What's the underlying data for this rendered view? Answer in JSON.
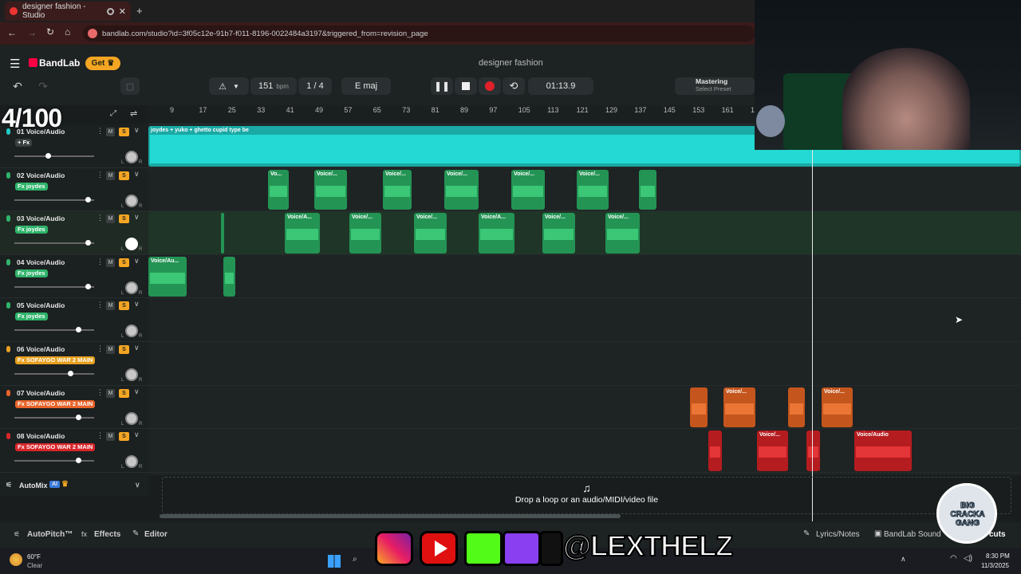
{
  "browser": {
    "tab_title": "designer fashion - Studio",
    "url": "bandlab.com/studio?id=3f05c12e-91b7-f011-8196-0022484a3197&triggered_from=revision_page"
  },
  "header": {
    "logo_text": "BandLab",
    "get_label": "Get",
    "project_title": "designer fashion",
    "bpm_value": "151",
    "bpm_unit": "bpm",
    "time_sig": "1 / 4",
    "key": "E maj",
    "time": "01:13.9",
    "mastering_title": "Mastering",
    "mastering_sub": "Select Preset"
  },
  "ruler": [
    "9",
    "17",
    "25",
    "33",
    "41",
    "49",
    "57",
    "65",
    "73",
    "81",
    "89",
    "97",
    "105",
    "113",
    "121",
    "129",
    "137",
    "145",
    "153",
    "161",
    "16"
  ],
  "tracks": [
    {
      "name": "01 Voice/Audio",
      "fx": "+ Fx",
      "color": "#23c9c4",
      "fx_bg": "#3a4041",
      "vol": 0.42
    },
    {
      "name": "02 Voice/Audio",
      "fx": "Fx joydes",
      "color": "#2fb36a",
      "fx_bg": "#2fb36a",
      "vol": 0.92
    },
    {
      "name": "03 Voice/Audio",
      "fx": "Fx joydes",
      "color": "#2fb36a",
      "fx_bg": "#2fb36a",
      "vol": 0.92
    },
    {
      "name": "04 Voice/Audio",
      "fx": "Fx joydes",
      "color": "#2fb36a",
      "fx_bg": "#2fb36a",
      "vol": 0.92
    },
    {
      "name": "05 Voice/Audio",
      "fx": "Fx joydes",
      "color": "#2fb36a",
      "fx_bg": "#2fb36a",
      "vol": 0.8
    },
    {
      "name": "06 Voice/Audio",
      "fx": "Fx SOFAYGO WAR 2 MAIN",
      "color": "#e6a020",
      "fx_bg": "#e6a020",
      "vol": 0.7
    },
    {
      "name": "07 Voice/Audio",
      "fx": "Fx SOFAYGO WAR 2 MAIN",
      "color": "#e8642a",
      "fx_bg": "#e8642a",
      "vol": 0.8
    },
    {
      "name": "08 Voice/Audio",
      "fx": "Fx SOFAYGO WAR 2 MAIN",
      "color": "#d9262a",
      "fx_bg": "#d9262a",
      "vol": 0.8
    }
  ],
  "clip_texts": {
    "main": "joydes + yuko + ghetto cupid type be",
    "va": "Voice/A...",
    "vv": "Voice/...",
    "vo": "Vo...",
    "vau": "Voice/Au...",
    "full": "Voice/Audio"
  },
  "automix": {
    "label": "AutoMix",
    "ai": "AI"
  },
  "drop_text": "Drop a loop or an audio/MIDI/video file",
  "bottom": {
    "autopitch": "AutoPitch™",
    "effects": "Effects",
    "editor": "Editor",
    "lyrics": "Lyrics/Notes",
    "sounds": "BandLab Sound",
    "shortcuts": "cuts"
  },
  "overlay": {
    "counter": "4/100",
    "handle": "@LEXTHELZ",
    "badge": "BIG CRACKA GANG"
  },
  "taskbar": {
    "temp": "60°F",
    "weather": "Clear",
    "time": "8:30 PM",
    "date": "11/3/2025"
  }
}
